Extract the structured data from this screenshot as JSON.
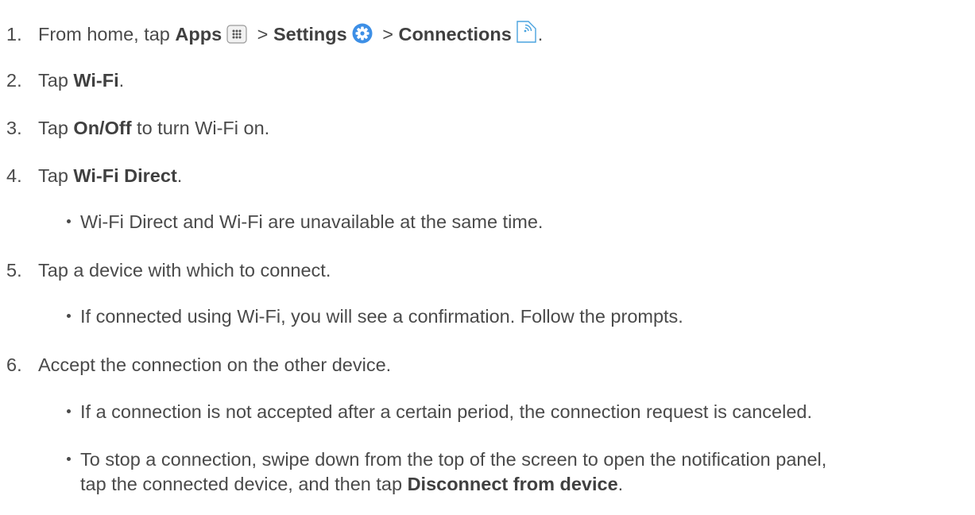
{
  "steps": [
    {
      "number": "1.",
      "intro": "From home, tap ",
      "apps": "Apps",
      "apps_icon": "apps-grid-icon",
      "sep1": " > ",
      "settings": "Settings",
      "settings_icon": "settings-gear-icon",
      "sep2": " > ",
      "connections": "Connections",
      "connections_icon": "connections-icon",
      "end": "."
    },
    {
      "number": "2.",
      "pre": "Tap ",
      "bold": "Wi-Fi",
      "post": "."
    },
    {
      "number": "3.",
      "pre": "Tap ",
      "bold": "On/Off",
      "post": " to turn Wi-Fi on."
    },
    {
      "number": "4.",
      "pre": "Tap ",
      "bold": "Wi-Fi Direct",
      "post": "."
    },
    {
      "number": "5.",
      "text": "Tap a device with which to connect."
    },
    {
      "number": "6.",
      "text": "Accept the connection on the other device."
    }
  ],
  "bullets": {
    "step4": "Wi-Fi Direct and Wi-Fi are unavailable at the same time.",
    "step5": "If connected using Wi-Fi, you will see a confirmation. Follow the prompts.",
    "step6a": "If a connection is not accepted after a certain period, the connection request is canceled.",
    "step6b_line1": "To stop a connection, swipe down from the top of the screen to open the notification panel,",
    "step6b_line2_pre": "tap the connected device, and then tap ",
    "step6b_line2_bold": "Disconnect from device",
    "step6b_line2_post": "."
  },
  "colors": {
    "text": "#4a4a4a",
    "settings_icon": "#3d8fe6",
    "connections_icon": "#4aa3df"
  }
}
